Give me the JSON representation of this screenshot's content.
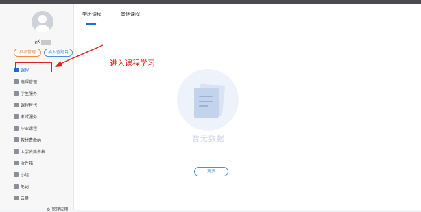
{
  "user": {
    "name": "赵",
    "buttons": {
      "left": "参考管理",
      "right": "插入查题目"
    }
  },
  "menu": [
    {
      "label": "课程",
      "icon": "graduation-cap-icon",
      "active": true
    },
    {
      "label": "选课管理",
      "icon": "list-icon",
      "active": false
    },
    {
      "label": "学生服务",
      "icon": "user-icon",
      "active": false
    },
    {
      "label": "课程替代",
      "icon": "swap-icon",
      "active": false
    },
    {
      "label": "考试服务",
      "icon": "exam-icon",
      "active": false
    },
    {
      "label": "毕业课程",
      "icon": "diploma-icon",
      "active": false
    },
    {
      "label": "教材费缴纳",
      "icon": "book-icon",
      "active": false
    },
    {
      "label": "入学资格审核",
      "icon": "shield-icon",
      "active": false
    },
    {
      "label": "收件箱",
      "icon": "inbox-icon",
      "active": false
    },
    {
      "label": "小组",
      "icon": "group-icon",
      "active": false
    },
    {
      "label": "笔记",
      "icon": "note-icon",
      "active": false
    },
    {
      "label": "云盘",
      "icon": "cloud-icon",
      "active": false
    }
  ],
  "manage_label": "管理应用",
  "tabs": [
    {
      "label": "学历课程",
      "active": true
    },
    {
      "label": "其他课程",
      "active": false
    }
  ],
  "empty_state": {
    "text": "暂无数据"
  },
  "more_button": "更多",
  "annotation": "进入课程学习",
  "colors": {
    "accent": "#1e6fd9",
    "annotation": "#e02020"
  }
}
